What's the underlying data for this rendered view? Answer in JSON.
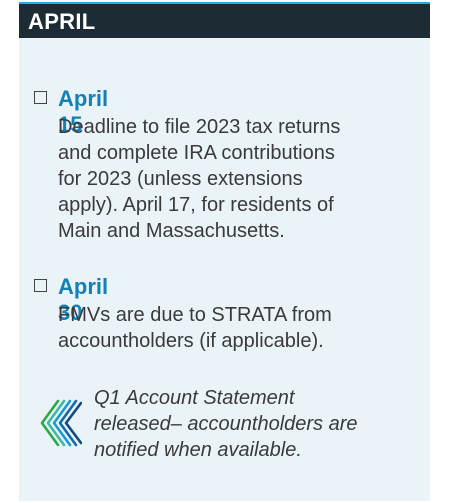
{
  "section": {
    "title": "APRIL"
  },
  "events": [
    {
      "date": "April 15",
      "description_lines": [
        "Deadline to file 2023 tax returns",
        "and complete IRA contributions",
        "for 2023 (unless extensions",
        "apply).  April 17, for residents of",
        "Main and Massachusetts."
      ]
    },
    {
      "date": "April 30",
      "description_lines": [
        "FMVs are due to STRATA from",
        "accountholders (if applicable)."
      ]
    }
  ],
  "note": {
    "icon": "strata-logo-icon",
    "lines": [
      "Q1 Account Statement",
      "released– accountholders are",
      "notified when available."
    ]
  },
  "colors": {
    "header_bg": "#1d2b34",
    "header_accent": "#27a9df",
    "card_bg": "#eaf3f7",
    "date_blue": "#1380b7",
    "body_text": "#3a3a3a"
  }
}
